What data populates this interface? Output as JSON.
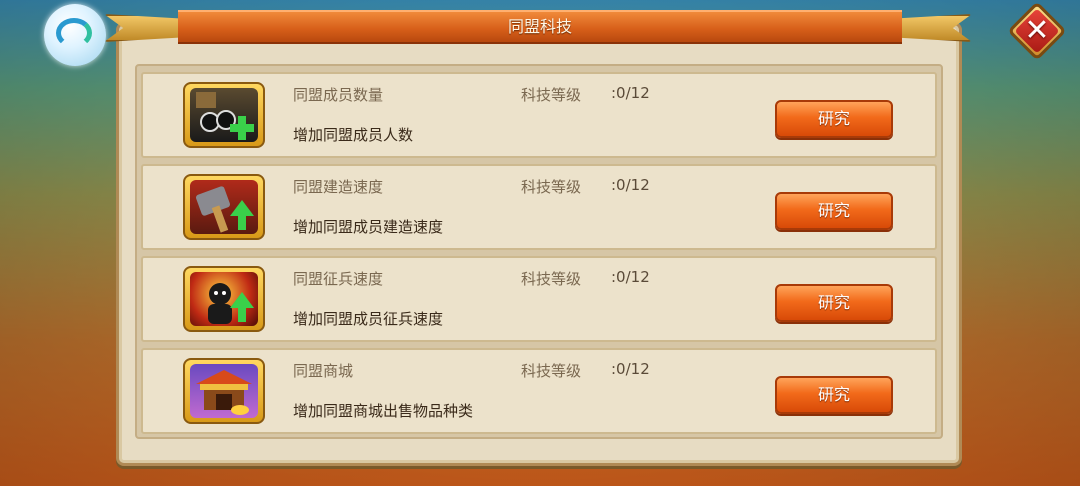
{
  "window": {
    "title": "同盟科技"
  },
  "colors": {
    "accent": "#e8601a",
    "panel": "#e7dcc3",
    "button": "#f26a1a"
  },
  "rows": [
    {
      "name": "同盟成员数量",
      "level_label": "科技等级",
      "level_value": ":0/12",
      "description": "增加同盟成员人数",
      "button_label": "研究",
      "icon": "members-plus-icon"
    },
    {
      "name": "同盟建造速度",
      "level_label": "科技等级",
      "level_value": ":0/12",
      "description": "增加同盟成员建造速度",
      "button_label": "研究",
      "icon": "hammer-build-icon"
    },
    {
      "name": "同盟征兵速度",
      "level_label": "科技等级",
      "level_value": ":0/12",
      "description": "增加同盟成员征兵速度",
      "button_label": "研究",
      "icon": "soldier-recruit-icon"
    },
    {
      "name": "同盟商城",
      "level_label": "科技等级",
      "level_value": ":0/12",
      "description": "增加同盟商城出售物品种类",
      "button_label": "研究",
      "icon": "shop-building-icon"
    }
  ],
  "close_button": {
    "icon": "close-icon"
  },
  "logo": {
    "icon": "game-logo-icon"
  }
}
